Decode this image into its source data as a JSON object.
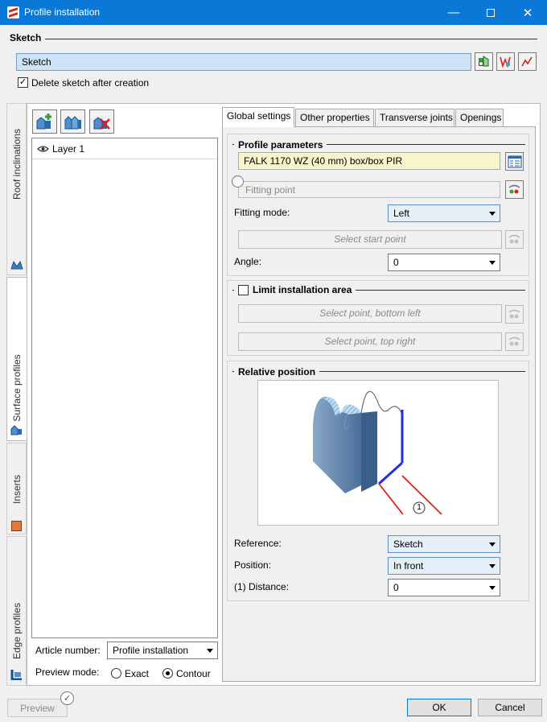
{
  "window": {
    "title": "Profile installation"
  },
  "sketch": {
    "group_label": "Sketch",
    "value": "Sketch",
    "delete_checked": true,
    "delete_label": "Delete sketch after creation"
  },
  "side_tabs": [
    {
      "label": "Roof inclinations"
    },
    {
      "label": "Surface profiles"
    },
    {
      "label": "Inserts"
    },
    {
      "label": "Edge profiles"
    }
  ],
  "layers": {
    "items": [
      {
        "label": "Layer 1"
      }
    ]
  },
  "article": {
    "label": "Article number:",
    "value": "Profile installation"
  },
  "preview_mode": {
    "label": "Preview mode:",
    "options": [
      "Exact",
      "Contour"
    ],
    "selected": "Contour"
  },
  "tabs": [
    {
      "label": "Global settings",
      "active": true
    },
    {
      "label": "Other properties",
      "active": false
    },
    {
      "label": "Transverse joints",
      "active": false
    },
    {
      "label": "Openings",
      "active": false
    }
  ],
  "profile_parameters": {
    "title": "Profile parameters",
    "profile_value": "FALK 1170 WZ (40 mm) box/box PIR",
    "fitting_point_placeholder": "Fitting point",
    "fitting_mode_label": "Fitting mode:",
    "fitting_mode_value": "Left",
    "start_point_placeholder": "Select start point",
    "angle_label": "Angle:",
    "angle_value": "0"
  },
  "limit_area": {
    "title": "Limit installation area",
    "checked": false,
    "bottom_left_placeholder": "Select point, bottom left",
    "top_right_placeholder": "Select point, top right"
  },
  "relative_position": {
    "title": "Relative position",
    "marker": "1",
    "reference_label": "Reference:",
    "reference_value": "Sketch",
    "position_label": "Position:",
    "position_value": "In front",
    "distance_label": "(1) Distance:",
    "distance_value": "0"
  },
  "footer": {
    "preview_label": "Preview",
    "ok_label": "OK",
    "cancel_label": "Cancel"
  },
  "colors": {
    "titlebar": "#0a78d7",
    "sketch_field": "#cde3f8",
    "profile_field": "#f7f5c9"
  }
}
